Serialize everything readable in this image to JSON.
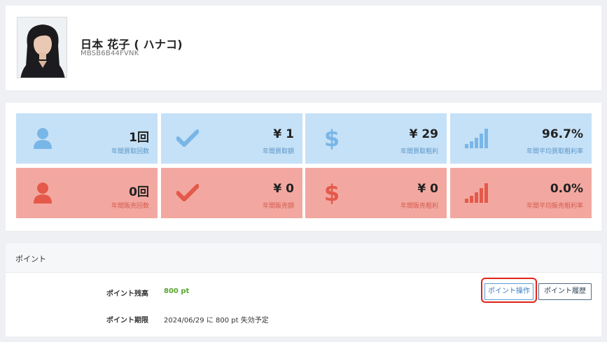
{
  "profile": {
    "name": "日本 花子 ( ハナコ)",
    "member_id": "MBSB6B44FVNK"
  },
  "colors": {
    "buy_tile_bg": "#c5e1f7",
    "buy_icon": "#79b6e8",
    "sell_tile_bg": "#f2a8a0",
    "sell_icon": "#e4594a",
    "points_value": "#5aa532",
    "highlight": "#e12318"
  },
  "stats": {
    "buy": [
      {
        "icon": "user-icon",
        "value": "1回",
        "label": "年間買取回数"
      },
      {
        "icon": "check-icon",
        "value": "¥ 1",
        "label": "年間買取額"
      },
      {
        "icon": "dollar-icon",
        "value": "¥ 29",
        "label": "年間買取粗利"
      },
      {
        "icon": "signal-bars-icon",
        "value": "96.7%",
        "label": "年間平均買取粗利率"
      }
    ],
    "sell": [
      {
        "icon": "user-icon",
        "value": "0回",
        "label": "年間販売回数"
      },
      {
        "icon": "check-icon",
        "value": "¥ 0",
        "label": "年間販売額"
      },
      {
        "icon": "dollar-icon",
        "value": "¥ 0",
        "label": "年間販売粗利"
      },
      {
        "icon": "signal-bars-icon",
        "value": "0.0%",
        "label": "年間平均販売粗利率"
      }
    ]
  },
  "points": {
    "title": "ポイント",
    "balance_label": "ポイント残高",
    "balance_value": "800 pt",
    "expiry_label": "ポイント期限",
    "expiry_value": "2024/06/29 に 800 pt 失効予定",
    "operate_button": "ポイント操作",
    "history_button": "ポイント履歴"
  }
}
